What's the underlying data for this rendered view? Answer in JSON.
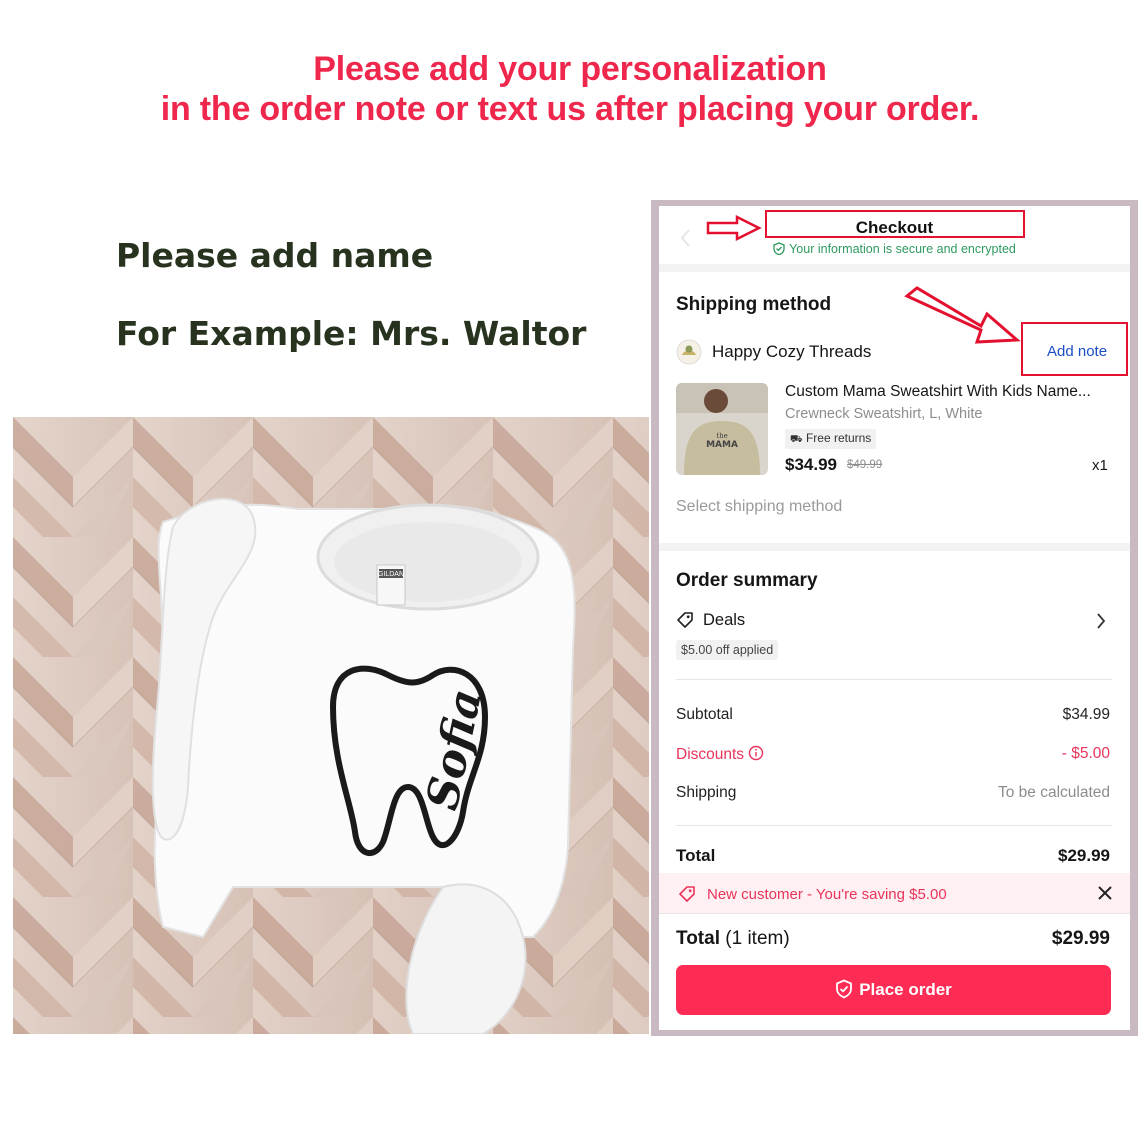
{
  "headline": {
    "line1": "Please add your personalization",
    "line2": "in the order note or text us after placing your order."
  },
  "instructions": {
    "line1": "Please add name",
    "line2": "For Example: Mrs. Waltor"
  },
  "product_photo": {
    "print_name": "Sofia",
    "tag_text": "GILDAN"
  },
  "checkout": {
    "title": "Checkout",
    "secure_text": "Your information is secure and encrypted",
    "shipping": {
      "heading": "Shipping method",
      "store_name": "Happy Cozy Threads",
      "add_note": "Add note",
      "item_title": "Custom Mama Sweatshirt With Kids Name...",
      "item_variant": "Crewneck Sweatshirt, L, White",
      "free_returns": "Free returns",
      "price": "$34.99",
      "old_price": "$49.99",
      "quantity": "x1",
      "select_method": "Select shipping method",
      "thumb_text_1": "the",
      "thumb_text_2": "MAMA"
    },
    "summary": {
      "heading": "Order summary",
      "deals_label": "Deals",
      "deals_chip": "$5.00 off applied",
      "subtotal_label": "Subtotal",
      "subtotal_value": "$34.99",
      "discounts_label": "Discounts",
      "discounts_value": "- $5.00",
      "shipping_label": "Shipping",
      "shipping_value": "To be calculated",
      "total_label": "Total",
      "total_value": "$29.99"
    },
    "banner_text": "New customer - You're saving $5.00",
    "footer_total_label": "Total",
    "footer_total_count": "(1 item)",
    "footer_total_value": "$29.99",
    "place_order": "Place order"
  },
  "colors": {
    "accent": "#fe2c55",
    "headline": "#f0274d",
    "secure_green": "#2e9a5f",
    "link_blue": "#1a4fc4",
    "annotation_red": "#e3102f"
  }
}
